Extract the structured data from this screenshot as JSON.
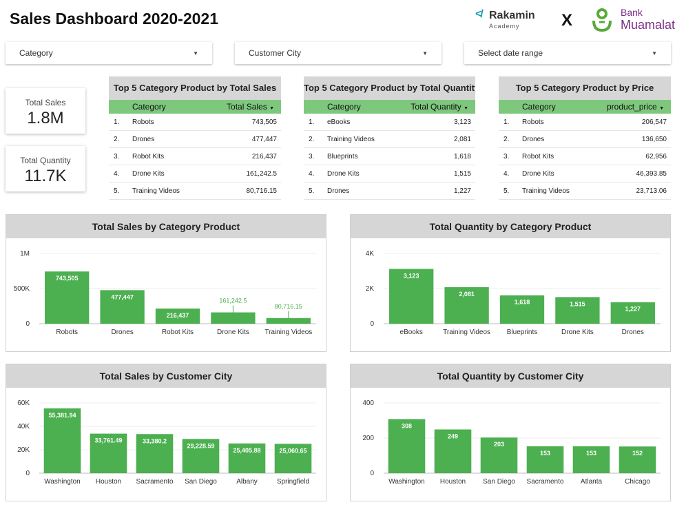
{
  "header": {
    "title": "Sales Dashboard 2020-2021",
    "logo_rakamin_name": "Rakamin",
    "logo_rakamin_sub": "Academy",
    "logo_separator": "X",
    "logo_bank_line1": "Bank",
    "logo_bank_line2": "Muamalat"
  },
  "filters": {
    "category": "Category",
    "city": "Customer City",
    "date": "Select date range"
  },
  "scorecards": {
    "total_sales_label": "Total Sales",
    "total_sales_value": "1.8M",
    "total_qty_label": "Total Quantity",
    "total_qty_value": "11.7K"
  },
  "tables": [
    {
      "title": "Top 5 Category Product by Total Sales",
      "col1": "Category",
      "col2": "Total Sales",
      "rows": [
        {
          "n": "1.",
          "c": "Robots",
          "v": "743,505"
        },
        {
          "n": "2.",
          "c": "Drones",
          "v": "477,447"
        },
        {
          "n": "3.",
          "c": "Robot Kits",
          "v": "216,437"
        },
        {
          "n": "4.",
          "c": "Drone Kits",
          "v": "161,242.5"
        },
        {
          "n": "5.",
          "c": "Training Videos",
          "v": "80,716.15"
        }
      ]
    },
    {
      "title": "Top 5 Category Product by Total Quantity",
      "col1": "Category",
      "col2": "Total Quantity",
      "rows": [
        {
          "n": "1.",
          "c": "eBooks",
          "v": "3,123"
        },
        {
          "n": "2.",
          "c": "Training Videos",
          "v": "2,081"
        },
        {
          "n": "3.",
          "c": "Blueprints",
          "v": "1,618"
        },
        {
          "n": "4.",
          "c": "Drone Kits",
          "v": "1,515"
        },
        {
          "n": "5.",
          "c": "Drones",
          "v": "1,227"
        }
      ]
    },
    {
      "title": "Top 5 Category Product by Price",
      "col1": "Category",
      "col2": "product_price",
      "rows": [
        {
          "n": "1.",
          "c": "Robots",
          "v": "206,547"
        },
        {
          "n": "2.",
          "c": "Drones",
          "v": "136,650"
        },
        {
          "n": "3.",
          "c": "Robot Kits",
          "v": "62,956"
        },
        {
          "n": "4.",
          "c": "Drone Kits",
          "v": "46,393.85"
        },
        {
          "n": "5.",
          "c": "Training Videos",
          "v": "23,713.06"
        }
      ]
    }
  ],
  "chart_data": [
    {
      "type": "bar",
      "title": "Total Sales by Category Product",
      "categories": [
        "Robots",
        "Drones",
        "Robot Kits",
        "Drone Kits",
        "Training Videos"
      ],
      "values": [
        743505,
        477447,
        216437,
        161242.5,
        80716.15
      ],
      "labels": [
        "743,505",
        "477,447",
        "216,437",
        "161,242.5",
        "80,716.15"
      ],
      "yticks": [
        "0",
        "500K",
        "1M"
      ],
      "ylim": [
        0,
        1000000
      ],
      "grid": true
    },
    {
      "type": "bar",
      "title": "Total Quantity by Category Product",
      "categories": [
        "eBooks",
        "Training Videos",
        "Blueprints",
        "Drone Kits",
        "Drones"
      ],
      "values": [
        3123,
        2081,
        1618,
        1515,
        1227
      ],
      "labels": [
        "3,123",
        "2,081",
        "1,618",
        "1,515",
        "1,227"
      ],
      "yticks": [
        "0",
        "2K",
        "4K"
      ],
      "ylim": [
        0,
        4000
      ],
      "grid": true
    },
    {
      "type": "bar",
      "title": "Total Sales by Customer City",
      "categories": [
        "Washington",
        "Houston",
        "Sacramento",
        "San Diego",
        "Albany",
        "Springfield"
      ],
      "values": [
        55381.94,
        33761.49,
        33380.2,
        29228.59,
        25405.88,
        25060.65
      ],
      "labels": [
        "55,381.94",
        "33,761.49",
        "33,380.2",
        "29,228.59",
        "25,405.88",
        "25,060.65"
      ],
      "yticks": [
        "0",
        "20K",
        "40K",
        "60K"
      ],
      "ylim": [
        0,
        60000
      ],
      "grid": true
    },
    {
      "type": "bar",
      "title": "Total Quantity by Customer City",
      "categories": [
        "Washington",
        "Houston",
        "San Diego",
        "Sacramento",
        "Atlanta",
        "Chicago"
      ],
      "values": [
        308,
        249,
        203,
        153,
        153,
        152
      ],
      "labels": [
        "308",
        "249",
        "203",
        "153",
        "153",
        "152"
      ],
      "yticks": [
        "0",
        "200",
        "400"
      ],
      "ylim": [
        0,
        400
      ],
      "grid": true
    }
  ],
  "colors": {
    "bar": "#4caf50",
    "table_header": "#7ec87d",
    "title_bg": "#d6d6d6",
    "outside_label": "#4caf50"
  }
}
